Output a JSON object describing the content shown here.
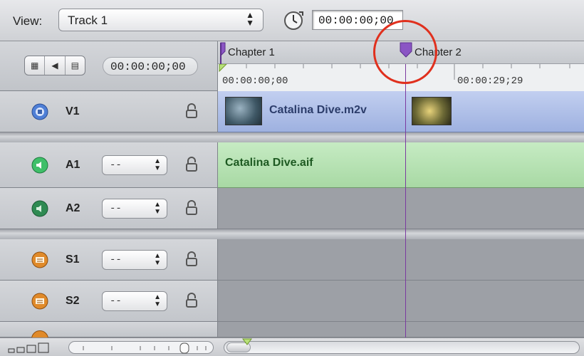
{
  "toolbar": {
    "view_label": "View:",
    "track_select_value": "Track 1",
    "timecode": "00:00:00;00"
  },
  "header": {
    "timecode": "00:00:00;00",
    "buttons": [
      "video-toggle-icon",
      "audio-toggle-icon",
      "subtitle-toggle-icon"
    ]
  },
  "ruler": {
    "chapters": [
      {
        "label": "Chapter 1"
      },
      {
        "label": "Chapter 2"
      }
    ],
    "times": [
      "00:00:00;00",
      "00:00:29;29"
    ]
  },
  "tracks": {
    "v1": {
      "name": "V1",
      "clip_title": "Catalina Dive.m2v"
    },
    "a1": {
      "name": "A1",
      "select_value": "--",
      "clip_title": "Catalina Dive.aif"
    },
    "a2": {
      "name": "A2",
      "select_value": "--"
    },
    "s1": {
      "name": "S1",
      "select_value": "--"
    },
    "s2": {
      "name": "S2",
      "select_value": "--"
    }
  },
  "colors": {
    "video_clip": "#a9b9e6",
    "audio_clip": "#b5e2b1",
    "playhead": "#7b3aa0",
    "annotation": "#e0301e"
  }
}
